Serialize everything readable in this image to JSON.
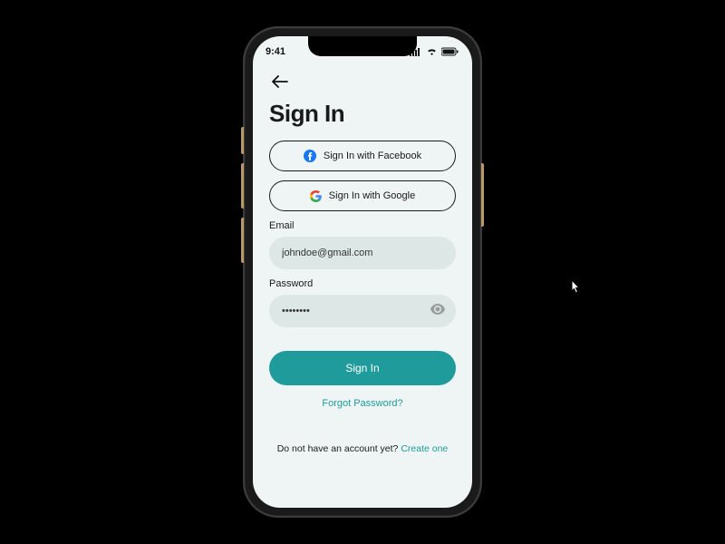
{
  "status": {
    "time": "9:41"
  },
  "title": "Sign In",
  "social": {
    "facebook": "Sign In with Facebook",
    "google": "Sign In with Google"
  },
  "fields": {
    "email_label": "Email",
    "email_value": "johndoe@gmail.com",
    "password_label": "Password",
    "password_value": "••••••••"
  },
  "primary_button": "Sign In",
  "forgot": "Forgot Password?",
  "signup": {
    "prompt": "Do not have an account yet? ",
    "link": "Create one"
  },
  "colors": {
    "accent": "#1f9b9b"
  }
}
